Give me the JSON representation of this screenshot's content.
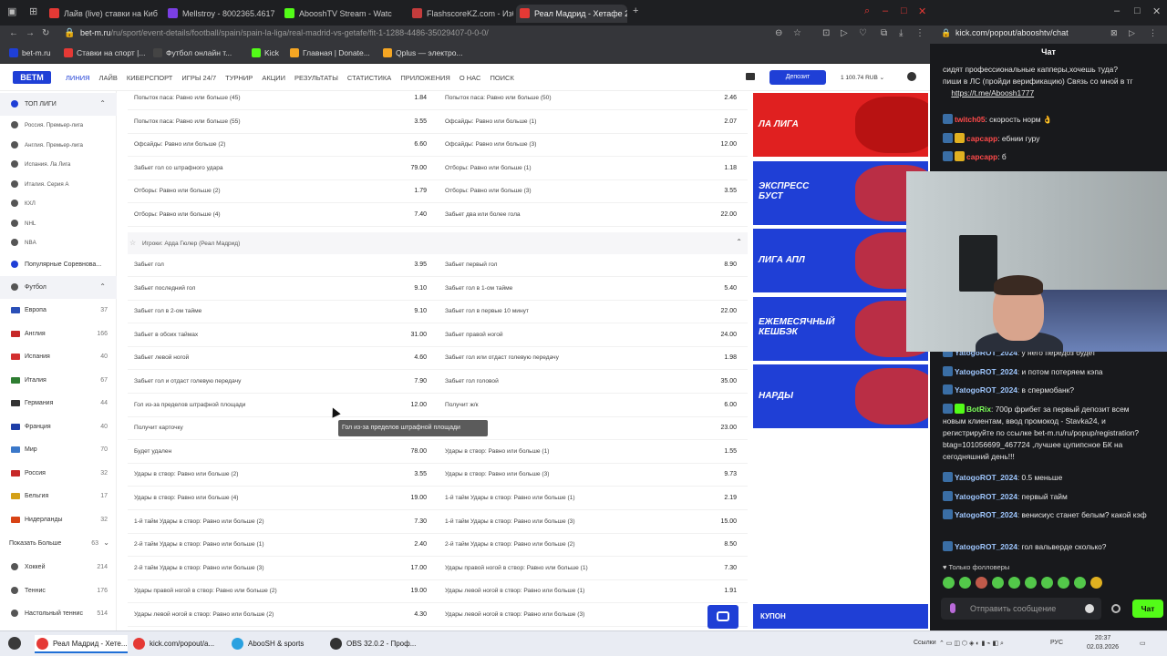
{
  "browser": {
    "tabs": [
      {
        "label": "Лайв (live) ставки на Киб",
        "color": "#e53935"
      },
      {
        "label": "Mellstroy - 8002365.4617",
        "color": "#7b3fe4"
      },
      {
        "label": "AbooshTV Stream - Watc",
        "color": "#53fc18"
      },
      {
        "label": "FlashscoreKZ.com - Избр",
        "color": "#c43c3c"
      },
      {
        "label": "Реал Мадрид - Хетафе 2",
        "color": "#e53935"
      }
    ],
    "new_tab": "+",
    "url_main": "bet-m.ru",
    "url_rest": "/ru/sport/event-details/football/spain/spain-la-liga/real-madrid-vs-getafe/fit-1-1288-4486-35029407-0-0-0/",
    "bookmarks": [
      {
        "label": "bet-m.ru",
        "color": "#1f3fd6"
      },
      {
        "label": "Ставки на спорт |...",
        "color": "#e53935"
      },
      {
        "label": "Футбол онлайн т...",
        "color": "#444"
      },
      {
        "label": "Kick",
        "color": "#53fc18"
      },
      {
        "label": "Главная | Donate...",
        "color": "#f5a623"
      },
      {
        "label": "Qplus — электро...",
        "color": "#f5a623"
      }
    ]
  },
  "site": {
    "logo": "BETM",
    "nav": [
      "ЛИНИЯ",
      "ЛАЙВ",
      "КИБЕРСПОРТ",
      "ИГРЫ 24/7",
      "ТУРНИР",
      "АКЦИИ",
      "РЕЗУЛЬТАТЫ",
      "СТАТИСТИКА",
      "ПРИЛОЖЕНИЯ",
      "О НАС",
      "ПОИСК"
    ],
    "deposit": "Депозит",
    "balance": "1 100.74 RUB"
  },
  "sidebar": {
    "top_leagues": "ТОП ЛИГИ",
    "leagues": [
      "Россия. Премьер-лига",
      "Англия. Премьер-лига",
      "Испания. Ла Лига",
      "Италия. Серия А",
      "КХЛ",
      "NHL",
      "NBA"
    ],
    "popular": "Популярные Соревнова...",
    "football": "Футбол",
    "countries": [
      {
        "name": "Европа",
        "count": "37",
        "color": "#2a4fb7"
      },
      {
        "name": "Англия",
        "count": "166",
        "color": "#c62828"
      },
      {
        "name": "Испания",
        "count": "40",
        "color": "#d32f2f"
      },
      {
        "name": "Италия",
        "count": "67",
        "color": "#2e7d32"
      },
      {
        "name": "Германия",
        "count": "44",
        "color": "#333"
      },
      {
        "name": "Франция",
        "count": "40",
        "color": "#1e3ea8"
      },
      {
        "name": "Мир",
        "count": "70",
        "color": "#3b78c9"
      },
      {
        "name": "Россия",
        "count": "32",
        "color": "#c62828"
      },
      {
        "name": "Бельгия",
        "count": "17",
        "color": "#d4a017"
      },
      {
        "name": "Нидерланды",
        "count": "32",
        "color": "#d84315"
      }
    ],
    "show_more": "Показать Больше",
    "show_more_count": "63",
    "sports": [
      {
        "name": "Хоккей",
        "count": "214"
      },
      {
        "name": "Теннис",
        "count": "176"
      },
      {
        "name": "Настольный теннис",
        "count": "514"
      }
    ]
  },
  "market": {
    "rows_top": [
      {
        "l": "Попыток паса: Равно или больше (45)",
        "lo": "1.84",
        "r": "Попыток паса: Равно или больше (50)",
        "ro": "2.46"
      },
      {
        "l": "Попыток паса: Равно или больше (55)",
        "lo": "3.55",
        "r": "Офсайды: Равно или больше (1)",
        "ro": "2.07"
      },
      {
        "l": "Офсайды: Равно или больше (2)",
        "lo": "6.60",
        "r": "Офсайды: Равно или больше (3)",
        "ro": "12.00"
      },
      {
        "l": "Забьет гол со штрафного удара",
        "lo": "79.00",
        "r": "Отборы: Равно или больше (1)",
        "ro": "1.18"
      },
      {
        "l": "Отборы: Равно или больше (2)",
        "lo": "1.79",
        "r": "Отборы: Равно или больше (3)",
        "ro": "3.55"
      },
      {
        "l": "Отборы: Равно или больше (4)",
        "lo": "7.40",
        "r": "Забьет два или более гола",
        "ro": "22.00"
      }
    ],
    "section_title": "Игроки: Арда Гюлер (Реал Мадрид)",
    "rows": [
      {
        "l": "Забьет гол",
        "lo": "3.95",
        "r": "Забьет первый гол",
        "ro": "8.90"
      },
      {
        "l": "Забьет последний гол",
        "lo": "9.10",
        "r": "Забьет гол в 1-ом тайме",
        "ro": "5.40"
      },
      {
        "l": "Забьет гол в 2-ом тайме",
        "lo": "9.10",
        "r": "Забьет гол в первые 10 минут",
        "ro": "22.00"
      },
      {
        "l": "Забьет в обоих таймах",
        "lo": "31.00",
        "r": "Забьет правой ногой",
        "ro": "24.00"
      },
      {
        "l": "Забьет левой ногой",
        "lo": "4.60",
        "r": "Забьет гол или отдаст голевую передачу",
        "ro": "1.98"
      },
      {
        "l": "Забьет гол и отдаст голевую передачу",
        "lo": "7.90",
        "r": "Забьет гол головой",
        "ro": "35.00"
      },
      {
        "l": "Гол из-за пределов штрафной площади",
        "lo": "12.00",
        "r": "Получит ж/к",
        "ro": "6.00"
      },
      {
        "l": "Получит карточку",
        "lo": "",
        "r": "...й карточку",
        "ro": "23.00"
      },
      {
        "l": "Будет удален",
        "lo": "78.00",
        "r": "Удары в створ: Равно или больше (1)",
        "ro": "1.55"
      },
      {
        "l": "Удары в створ: Равно или больше (2)",
        "lo": "3.55",
        "r": "Удары в створ: Равно или больше (3)",
        "ro": "9.73"
      },
      {
        "l": "Удары в створ: Равно или больше (4)",
        "lo": "19.00",
        "r": "1-й тайм Удары в створ: Равно или больше (1)",
        "ro": "2.19"
      },
      {
        "l": "1-й тайм Удары в створ: Равно или больше (2)",
        "lo": "7.30",
        "r": "1-й тайм Удары в створ: Равно или больше (3)",
        "ro": "15.00"
      },
      {
        "l": "2-й тайм Удары в створ: Равно или больше (1)",
        "lo": "2.40",
        "r": "2-й тайм Удары в створ: Равно или больше (2)",
        "ro": "8.50"
      },
      {
        "l": "2-й тайм Удары в створ: Равно или больше (3)",
        "lo": "17.00",
        "r": "Удары правой ногой в створ: Равно или больше (1)",
        "ro": "7.30"
      },
      {
        "l": "Удары правой ногой в створ: Равно или больше (2)",
        "lo": "19.00",
        "r": "Удары левой ногой в створ: Равно или больше (1)",
        "ro": "1.91"
      },
      {
        "l": "Удары левой ногой в створ: Равно или больше (2)",
        "lo": "4.30",
        "r": "Удары левой ногой в створ: Равно или больше (3)",
        "ro": "13.00"
      }
    ],
    "tooltip": "Гол из-за пределов штрафной площади"
  },
  "promos": {
    "items": [
      {
        "text": "ЛА ЛИГА",
        "color": "#e02020"
      },
      {
        "text": "ЭКСПРЕСС\nБУСТ",
        "color": "#1f3fd6"
      },
      {
        "text": "ЛИГА АПЛ",
        "color": "#1f3fd6"
      },
      {
        "text": "ЕЖЕМЕСЯЧНЫЙ\nКЕШБЭК",
        "color": "#1f3fd6"
      },
      {
        "text": "НАРДЫ",
        "color": "#1f3fd6"
      }
    ],
    "coupon": "КУПОН"
  },
  "kick": {
    "url": "kick.com/popout/abooshtv/chat",
    "title": "Чат",
    "pinned_line1": "сидят профессиональные капперы,хочешь туда?",
    "pinned_line2": "пиши в ЛС (пройди верификацию) Связь со мной в тг",
    "pinned_link": "https://t.me/Aboosh1777",
    "messages_top": [
      {
        "user": "twitch05",
        "text": ": скорость норм 👌",
        "color": "red"
      },
      {
        "user": "сарсарр",
        "text": ": ебнии гуру",
        "color": "red"
      },
      {
        "user": "сарсарр",
        "text": ": б",
        "color": "red"
      }
    ],
    "messages": [
      {
        "user": "YatogoROT_2024",
        "text": ": у него передоз будет"
      },
      {
        "user": "YatogoROT_2024",
        "text": ": и потом потеряем кэпа"
      },
      {
        "user": "YatogoROT_2024",
        "text": ": в спермобанк?"
      },
      {
        "user": "BotRix",
        "text": ": 700р фрибет за первый депозит всем новым клиентам, ввод промокод - Stavka24, и регистрируйте по ссылке bet-m.ru/ru/popup/registration?btag=101056699_467724 ,лучшее цупипсное БК на сегодняшний день!!!"
      },
      {
        "user": "YatogoROT_2024",
        "text": ": 0.5 меньше"
      },
      {
        "user": "YatogoROT_2024",
        "text": ": первый тайм"
      },
      {
        "user": "YatogoROT_2024",
        "text": ": венисиус станет белым? какой кэф"
      },
      {
        "user": "YatogoROT_2024",
        "text": ": гол вальверде сколько?"
      }
    ],
    "followers_only": "♥ Только фолловеры",
    "input_placeholder": "Отправить сообщение",
    "send": "Чат"
  },
  "taskbar": {
    "items": [
      {
        "label": "Реал Мадрид - Хете...",
        "color": "#e53935"
      },
      {
        "label": "kick.com/popout/a...",
        "color": "#e53935"
      },
      {
        "label": "AbooSH & sports",
        "color": "#2aa1e0"
      },
      {
        "label": "OBS 32.0.2 - Проф...",
        "color": "#333"
      }
    ],
    "links": "Ссылки",
    "lang": "РУС",
    "time": "20:37",
    "date": "02.03.2026"
  }
}
